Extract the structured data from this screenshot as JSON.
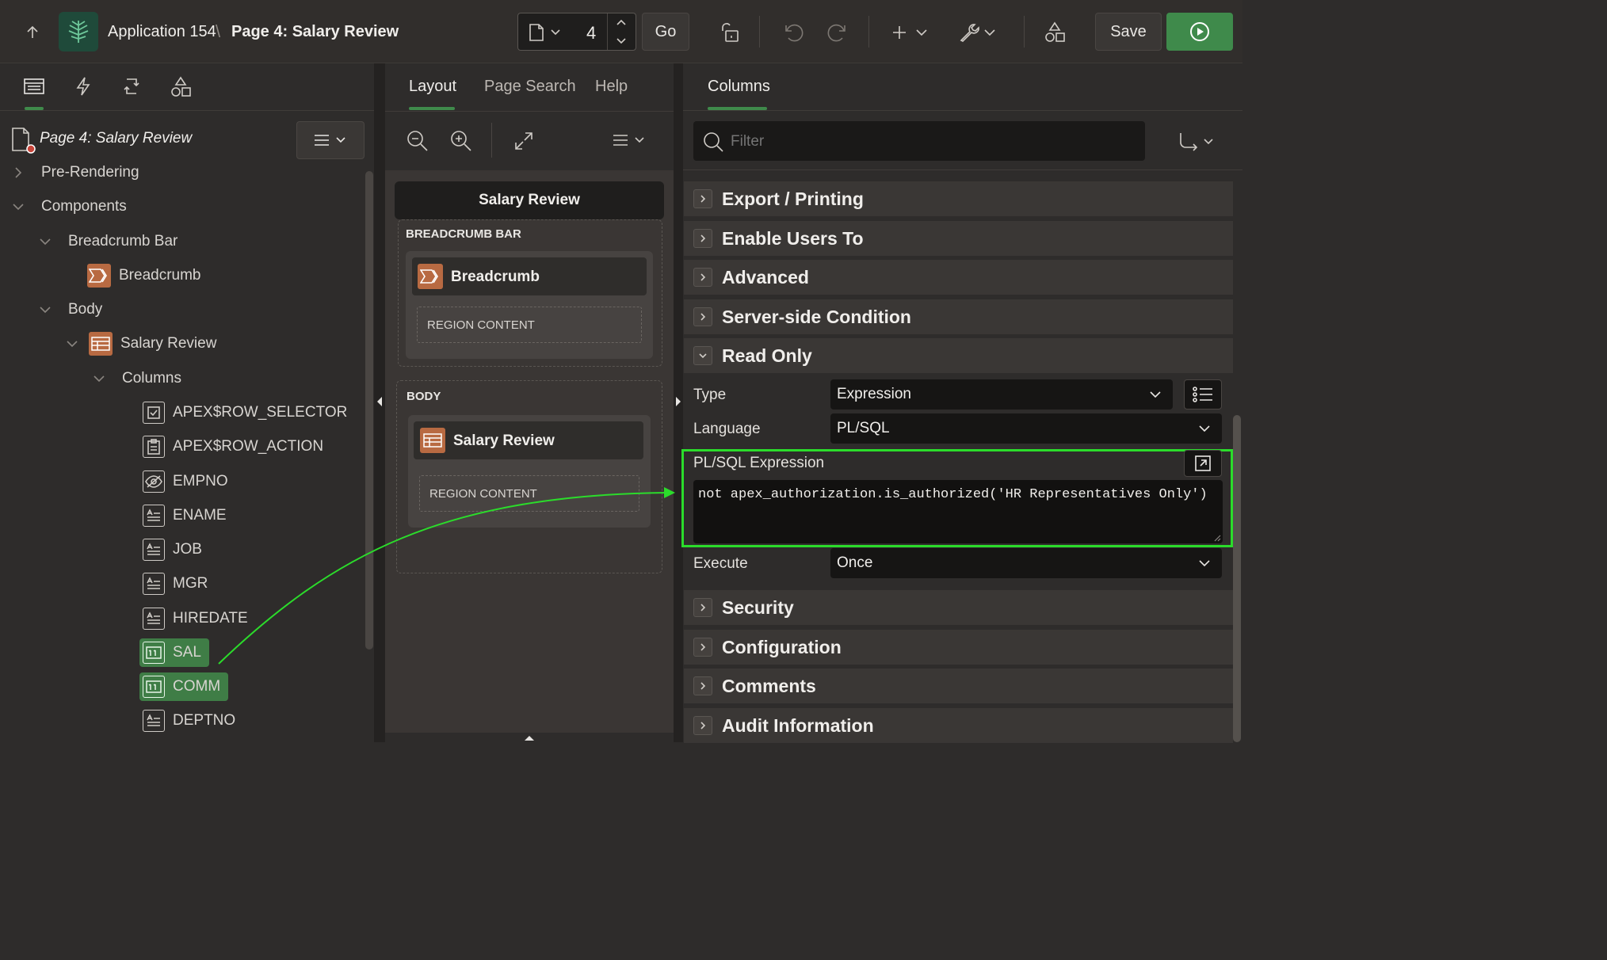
{
  "header": {
    "app_name": "Application 154",
    "breadcrumb_sep": "\\",
    "page_title": "Page 4: Salary Review",
    "page_number": "4",
    "go_label": "Go",
    "save_label": "Save"
  },
  "left": {
    "page_node": "Page 4: Salary Review",
    "tree": {
      "pre_rendering": "Pre-Rendering",
      "components": "Components",
      "breadcrumb_bar": "Breadcrumb Bar",
      "breadcrumb": "Breadcrumb",
      "body": "Body",
      "salary_review": "Salary Review",
      "columns": "Columns",
      "cols": [
        "APEX$ROW_SELECTOR",
        "APEX$ROW_ACTION",
        "EMPNO",
        "ENAME",
        "JOB",
        "MGR",
        "HIREDATE",
        "SAL",
        "COMM",
        "DEPTNO"
      ]
    }
  },
  "middle": {
    "tabs": [
      "Layout",
      "Page Search",
      "Help"
    ],
    "page_header": "Salary Review",
    "breadcrumb_bar_label": "BREADCRUMB BAR",
    "breadcrumb_region": "Breadcrumb",
    "region_content": "REGION CONTENT",
    "body_label": "BODY",
    "salary_region": "Salary Review"
  },
  "right": {
    "tab": "Columns",
    "filter_placeholder": "Filter",
    "sections_top": [
      "Export / Printing",
      "Enable Users To",
      "Advanced",
      "Server-side Condition"
    ],
    "read_only": "Read Only",
    "type_label": "Type",
    "type_value": "Expression",
    "language_label": "Language",
    "language_value": "PL/SQL",
    "expr_label": "PL/SQL Expression",
    "expr_value": "not apex_authorization.is_authorized('HR Representatives Only')",
    "execute_label": "Execute",
    "execute_value": "Once",
    "sections_bottom": [
      "Security",
      "Configuration",
      "Comments",
      "Audit Information"
    ]
  },
  "colors": {
    "accent_green": "#3f8a4b",
    "highlight_green": "#2bdc2b",
    "region_icon_orange": "#b86a42"
  }
}
